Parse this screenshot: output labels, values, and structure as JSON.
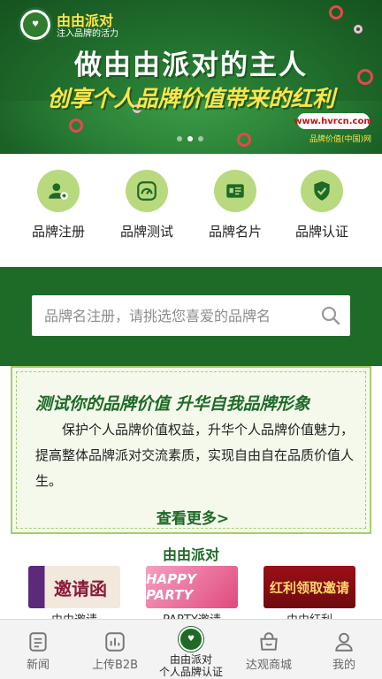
{
  "banner": {
    "brand_name": "由由派对",
    "brand_slogan": "注入品牌的活力",
    "headline1": "做由由派对的主人",
    "headline2": "创享个人品牌价值带来的红利",
    "site_badge": "www.hvrcn.com",
    "site_caption": "品牌价值(中国)网"
  },
  "features": [
    {
      "label": "品牌注册",
      "icon": "user-add-icon"
    },
    {
      "label": "品牌测试",
      "icon": "gauge-icon"
    },
    {
      "label": "品牌名片",
      "icon": "id-card-icon"
    },
    {
      "label": "品牌认证",
      "icon": "shield-check-icon"
    }
  ],
  "search": {
    "placeholder": "品牌名注册，请挑选您喜爱的品牌名"
  },
  "card": {
    "title": "测试你的品牌价值 升华自我品牌形象",
    "body": "保护个人品牌价值权益，升华个人品牌价值魅力，提高整体品牌派对交流素质，实现自由自在品质价值人生。",
    "more": "查看更多>"
  },
  "party": {
    "title": "由由派对",
    "items": [
      {
        "image_text": "邀请函",
        "caption": "由由邀请"
      },
      {
        "image_text": "HAPPY PARTY",
        "caption": "PARTY邀请"
      },
      {
        "image_text": "红利领取邀请",
        "caption": "由由红利"
      }
    ]
  },
  "tabbar": {
    "items": [
      {
        "label": "新闻",
        "icon": "news-icon"
      },
      {
        "label": "上传B2B",
        "icon": "chart-icon"
      },
      {
        "label": "由由派对\n个人品牌认证",
        "icon": "brand-logo-icon"
      },
      {
        "label": "达观商城",
        "icon": "shop-icon"
      },
      {
        "label": "我的",
        "icon": "profile-icon"
      }
    ]
  },
  "colors": {
    "primary_green": "#1e6a27",
    "light_green": "#b9d97e",
    "accent_yellow": "#ffe54a"
  }
}
